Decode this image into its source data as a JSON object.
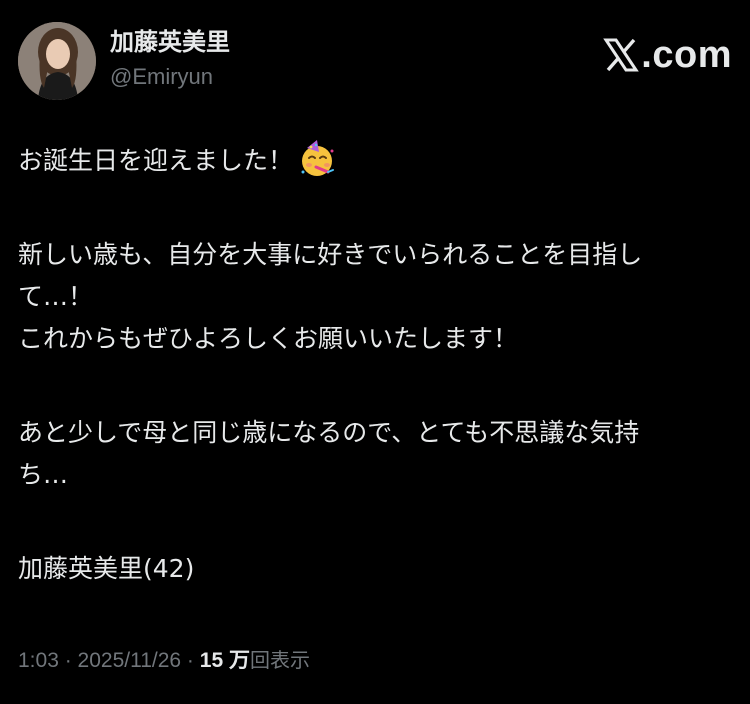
{
  "author": {
    "display_name": "加藤英美里",
    "handle": "@Emiryun",
    "avatar_icon": "profile-photo"
  },
  "brand": {
    "icon": "x-logo-icon",
    "text": ".com"
  },
  "tweet": {
    "line1": "お誕生日を迎えました！",
    "emoji": "partying-face",
    "line2": "新しい歳も、自分を大事に好きでいられることを目指し",
    "line3": "て…！",
    "line4": "これからもぜひよろしくお願いいたします！",
    "line5": "あと少しで母と同じ歳になるので、とても不思議な気持",
    "line6": "ち…",
    "line7": "加藤英美里(42)"
  },
  "meta": {
    "time": "1:03",
    "sep1": " · ",
    "date": "2025/11/26",
    "sep2": " · ",
    "views_count": "15 万",
    "views_label": "回表示"
  },
  "colors": {
    "background": "#000000",
    "text": "#e7e9ea",
    "secondary": "#71767b"
  }
}
